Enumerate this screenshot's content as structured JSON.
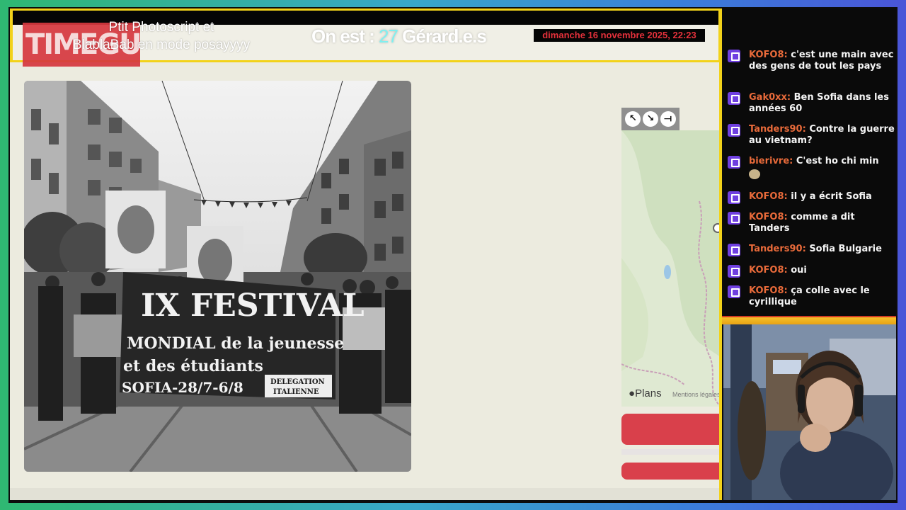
{
  "overlay": {
    "logo_text": "TIMEGUESSR",
    "title_line1": "Ptit Photoscript et",
    "title_line2": "BlablaBab en mode posayyyy",
    "counter_prefix": "On est : ",
    "counter_value": "27",
    "counter_suffix": " Gérard.e.s",
    "datetime": "dimanche 16 novembre 2025, 22:23"
  },
  "map": {
    "tools": [
      {
        "icon": "expand-arrow-icon",
        "glyph": "↖"
      },
      {
        "icon": "shrink-arrow-icon",
        "glyph": "↘"
      },
      {
        "icon": "pin-icon",
        "glyph": "⟞"
      }
    ],
    "brand": "Plans",
    "legal": "Mentions légales"
  },
  "photo": {
    "banner_line1": "IX FESTIVAL",
    "banner_line2": "MONDIAL de la jeunesse",
    "banner_line3": "et des étudiants",
    "banner_line4": "SOFIA-28/7-6/8",
    "banner_note1": "DELEGATION",
    "banner_note2": "ITALIENNE"
  },
  "chat": {
    "messages": [
      {
        "user": "KOFO8:",
        "text": "c'est une main avec des gens de tout les pays"
      },
      {
        "user": "Gak0xx:",
        "text": "Ben Sofia dans les années 60"
      },
      {
        "user": "Tanders90:",
        "text": "Contre la guerre au vietnam?"
      },
      {
        "user": "bierivre:",
        "text": "C'est ho chi min"
      },
      {
        "user": "KOFO8:",
        "text": "il y a écrit Sofia"
      },
      {
        "user": "KOFO8:",
        "text": "comme a dit Tanders"
      },
      {
        "user": "Tanders90:",
        "text": "Sofia Bulgarie"
      },
      {
        "user": "KOFO8:",
        "text": "oui"
      },
      {
        "user": "KOFO8:",
        "text": "ça colle avec le cyrillique"
      }
    ]
  },
  "colors": {
    "accent_yellow": "#f2d21a",
    "accent_red": "#d9404b",
    "chat_username": "#e86a3a",
    "badge_purple": "#6f3fe0"
  }
}
